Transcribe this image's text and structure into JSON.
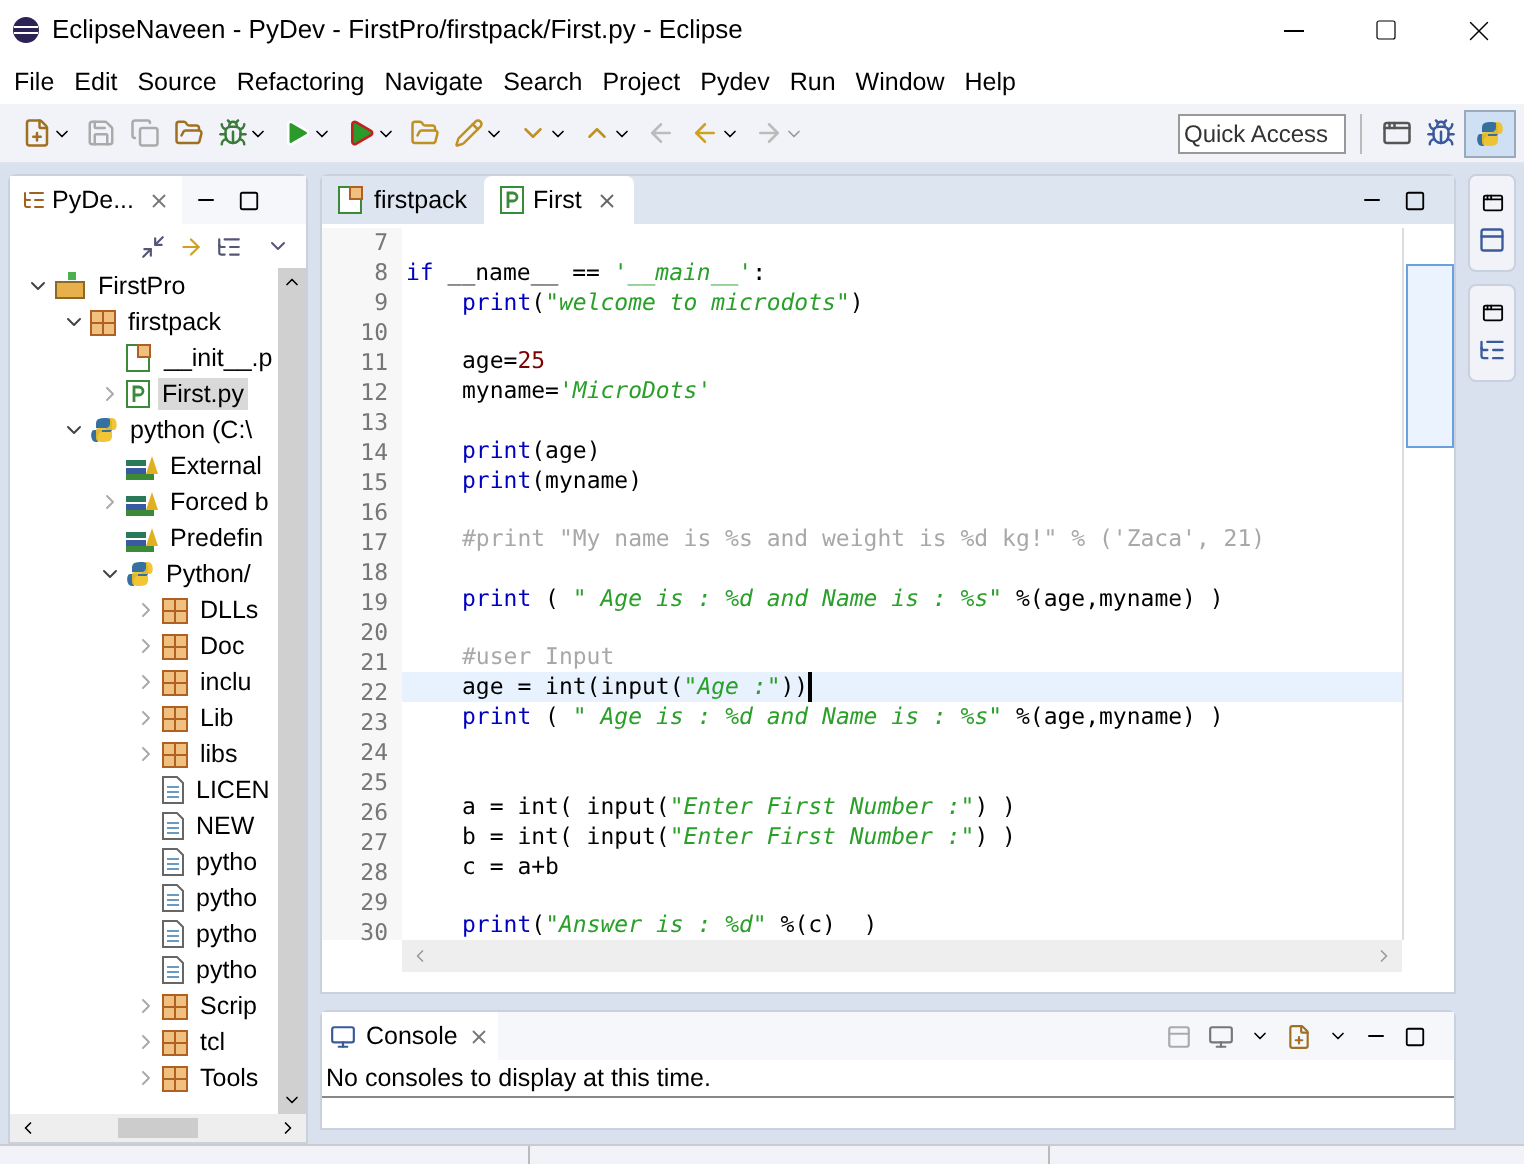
{
  "window": {
    "title": "EclipseNaveen - PyDev - FirstPro/firstpack/First.py - Eclipse"
  },
  "menu": [
    "File",
    "Edit",
    "Source",
    "Refactoring",
    "Navigate",
    "Search",
    "Project",
    "Pydev",
    "Run",
    "Window",
    "Help"
  ],
  "toolbar": {
    "quick_access": {
      "value": "Quick Access"
    }
  },
  "explorer": {
    "tab": "PyDe...",
    "tree": [
      {
        "label": "FirstPro",
        "kind": "project",
        "expanded": true,
        "selected": false,
        "children": [
          {
            "label": "firstpack",
            "kind": "package",
            "expanded": true,
            "selected": false,
            "children": [
              {
                "label": "__init__.p",
                "kind": "initfile",
                "selected": false
              },
              {
                "label": "First.py",
                "kind": "pyfile",
                "expanded": false,
                "selected": true
              }
            ]
          },
          {
            "label": "python  (C:\\",
            "kind": "interpreter",
            "expanded": true,
            "selected": false,
            "children": [
              {
                "label": "External",
                "kind": "lib",
                "selected": false
              },
              {
                "label": "Forced b",
                "kind": "lib",
                "expanded": false,
                "selected": false
              },
              {
                "label": "Predefin",
                "kind": "lib",
                "selected": false
              },
              {
                "label": "Python/",
                "kind": "interpreter",
                "expanded": true,
                "selected": false,
                "children": [
                  {
                    "label": "DLLs",
                    "kind": "package",
                    "expanded": false,
                    "selected": false
                  },
                  {
                    "label": "Doc",
                    "kind": "package",
                    "expanded": false,
                    "selected": false
                  },
                  {
                    "label": "inclu",
                    "kind": "package",
                    "expanded": false,
                    "selected": false
                  },
                  {
                    "label": "Lib",
                    "kind": "package",
                    "expanded": false,
                    "selected": false
                  },
                  {
                    "label": "libs",
                    "kind": "package",
                    "expanded": false,
                    "selected": false
                  },
                  {
                    "label": "LICEN",
                    "kind": "file",
                    "selected": false
                  },
                  {
                    "label": "NEW",
                    "kind": "file",
                    "selected": false
                  },
                  {
                    "label": "pytho",
                    "kind": "file",
                    "selected": false
                  },
                  {
                    "label": "pytho",
                    "kind": "file",
                    "selected": false
                  },
                  {
                    "label": "pytho",
                    "kind": "file",
                    "selected": false
                  },
                  {
                    "label": "pytho",
                    "kind": "file",
                    "selected": false
                  },
                  {
                    "label": "Scrip",
                    "kind": "package",
                    "expanded": false,
                    "selected": false
                  },
                  {
                    "label": "tcl",
                    "kind": "package",
                    "expanded": false,
                    "selected": false
                  },
                  {
                    "label": "Tools",
                    "kind": "package",
                    "expanded": false,
                    "selected": false
                  }
                ]
              }
            ]
          }
        ]
      }
    ]
  },
  "editor": {
    "tabs": [
      {
        "label": "firstpack",
        "kind": "package",
        "selected": false
      },
      {
        "label": "First",
        "kind": "pyfile",
        "selected": true
      }
    ],
    "lines": [
      {
        "number": "7",
        "current": false
      },
      {
        "number": "8",
        "current": false,
        "indented": false,
        "tokens": [
          {
            "kind": "keyword",
            "text": "if"
          },
          {
            "kind": "plain",
            "text": " __name__ == "
          },
          {
            "kind": "string",
            "text": "'__main__'"
          },
          {
            "kind": "plain",
            "text": ":"
          }
        ]
      },
      {
        "number": "9",
        "current": false,
        "indented": true,
        "tokens": [
          {
            "kind": "keyword",
            "text": "print"
          },
          {
            "kind": "plain",
            "text": "("
          },
          {
            "kind": "string",
            "text": "\"welcome to microdots\""
          },
          {
            "kind": "plain",
            "text": ")"
          }
        ]
      },
      {
        "number": "10",
        "current": false
      },
      {
        "number": "11",
        "current": false,
        "indented": true,
        "tokens": [
          {
            "kind": "plain",
            "text": "age="
          },
          {
            "kind": "number",
            "text": "25"
          }
        ]
      },
      {
        "number": "12",
        "current": false,
        "indented": true,
        "tokens": [
          {
            "kind": "plain",
            "text": "myname="
          },
          {
            "kind": "string",
            "text": "'MicroDots'"
          }
        ]
      },
      {
        "number": "13",
        "current": false
      },
      {
        "number": "14",
        "current": false,
        "indented": true,
        "tokens": [
          {
            "kind": "keyword",
            "text": "print"
          },
          {
            "kind": "plain",
            "text": "(age)"
          }
        ]
      },
      {
        "number": "15",
        "current": false,
        "indented": true,
        "tokens": [
          {
            "kind": "keyword",
            "text": "print"
          },
          {
            "kind": "plain",
            "text": "(myname)"
          }
        ]
      },
      {
        "number": "16",
        "current": false
      },
      {
        "number": "17",
        "current": false,
        "indented": true,
        "tokens": [
          {
            "kind": "comment",
            "text": "#print \"My name is %s and weight is %d kg!\" % ('Zaca', 21)"
          }
        ]
      },
      {
        "number": "18",
        "current": false
      },
      {
        "number": "19",
        "current": false,
        "indented": true,
        "tokens": [
          {
            "kind": "keyword",
            "text": "print"
          },
          {
            "kind": "plain",
            "text": " ( "
          },
          {
            "kind": "string",
            "text": "\" Age is : %d and Name is : %s\""
          },
          {
            "kind": "plain",
            "text": " %(age,myname) )"
          }
        ]
      },
      {
        "number": "20",
        "current": false
      },
      {
        "number": "21",
        "current": false,
        "indented": true,
        "tokens": [
          {
            "kind": "comment",
            "text": "#user Input"
          }
        ]
      },
      {
        "number": "22",
        "current": true,
        "indented": true,
        "tokens": [
          {
            "kind": "plain",
            "text": "age = int(input("
          },
          {
            "kind": "string",
            "text": "\"Age :\""
          },
          {
            "kind": "plain",
            "text": "))"
          }
        ]
      },
      {
        "number": "23",
        "current": false,
        "indented": true,
        "tokens": [
          {
            "kind": "keyword",
            "text": "print"
          },
          {
            "kind": "plain",
            "text": " ( "
          },
          {
            "kind": "string",
            "text": "\" Age is : %d and Name is : %s\""
          },
          {
            "kind": "plain",
            "text": " %(age,myname) )"
          }
        ]
      },
      {
        "number": "24",
        "current": false
      },
      {
        "number": "25",
        "current": false
      },
      {
        "number": "26",
        "current": false,
        "indented": true,
        "tokens": [
          {
            "kind": "plain",
            "text": "a = int( input("
          },
          {
            "kind": "string",
            "text": "\"Enter First Number :\""
          },
          {
            "kind": "plain",
            "text": ") )"
          }
        ]
      },
      {
        "number": "27",
        "current": false,
        "indented": true,
        "tokens": [
          {
            "kind": "plain",
            "text": "b = int( input("
          },
          {
            "kind": "string",
            "text": "\"Enter First Number :\""
          },
          {
            "kind": "plain",
            "text": ") )"
          }
        ]
      },
      {
        "number": "28",
        "current": false,
        "indented": true,
        "tokens": [
          {
            "kind": "plain",
            "text": "c = a+b"
          }
        ]
      },
      {
        "number": "29",
        "current": false
      },
      {
        "number": "30",
        "current": false,
        "indented": true,
        "tokens": [
          {
            "kind": "keyword",
            "text": "print"
          },
          {
            "kind": "plain",
            "text": "("
          },
          {
            "kind": "string",
            "text": "\"Answer is : %d\""
          },
          {
            "kind": "plain",
            "text": " %(c)  )"
          }
        ]
      }
    ]
  },
  "console": {
    "tab": "Console",
    "message": "No consoles to display at this time."
  }
}
